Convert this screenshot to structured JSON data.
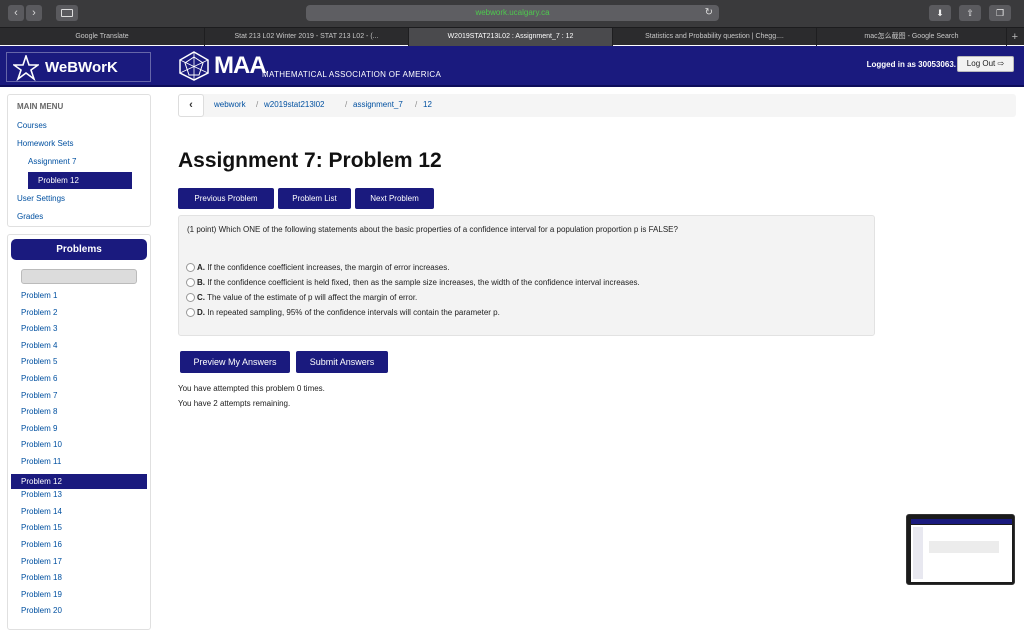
{
  "browser": {
    "url": "webwork.ucalgary.ca",
    "tabs": [
      "Google Translate",
      "Stat 213 L02 Winter 2019 - STAT 213 L02 - (...",
      "W2019STAT213L02 : Assignment_7 : 12",
      "Statistics and Probability question | Chegg....",
      "mac怎么截图 - Google Search"
    ],
    "active_tab_index": 2,
    "new_tab_symbol": "+",
    "back_symbol": "‹",
    "forward_symbol": "›",
    "reload_symbol": "↻"
  },
  "header": {
    "logo_text": "WeBWorK",
    "maa_title": "MAA",
    "maa_subtitle": "MATHEMATICAL ASSOCIATION OF AMERICA",
    "logged_in": "Logged in as 30053063.",
    "logout_label": "Log Out ⇨"
  },
  "main_menu": {
    "heading": "MAIN MENU",
    "courses": "Courses",
    "homework_sets": "Homework Sets",
    "assignment": "Assignment 7",
    "problem": "Problem 12",
    "user_settings": "User Settings",
    "grades": "Grades"
  },
  "problems_panel": {
    "title": "Problems",
    "items": [
      "Problem 1",
      "Problem 2",
      "Problem 3",
      "Problem 4",
      "Problem 5",
      "Problem 6",
      "Problem 7",
      "Problem 8",
      "Problem 9",
      "Problem 10",
      "Problem 11",
      "Problem 12",
      "Problem 13",
      "Problem 14",
      "Problem 15",
      "Problem 16",
      "Problem 17",
      "Problem 18",
      "Problem 19",
      "Problem 20"
    ],
    "active_index": 11
  },
  "breadcrumb": {
    "back": "‹",
    "items": [
      "webwork",
      "w2019stat213l02",
      "assignment_7",
      "12"
    ],
    "separator": "/"
  },
  "page": {
    "title": "Assignment 7: Problem 12",
    "prev_button": "Previous Problem",
    "list_button": "Problem List",
    "next_button": "Next Problem"
  },
  "problem": {
    "question": "(1 point) Which ONE of the following statements about the basic properties of a confidence interval for a population proportion p is FALSE?",
    "options": [
      {
        "letter": "A.",
        "text": " If the confidence coefficient increases, the margin of error increases."
      },
      {
        "letter": "B.",
        "text": " If the confidence coefficient is held fixed, then as the sample size increases, the width of the confidence interval increases."
      },
      {
        "letter": "C.",
        "text": " The value of the estimate of p will affect the margin of error."
      },
      {
        "letter": "D.",
        "text": " In repeated sampling, 95% of the confidence intervals will contain the parameter p."
      }
    ]
  },
  "actions": {
    "preview": "Preview My Answers",
    "submit": "Submit Answers"
  },
  "attempts": {
    "line1": "You have attempted this problem 0 times.",
    "line2": "You have 2 attempts remaining."
  }
}
